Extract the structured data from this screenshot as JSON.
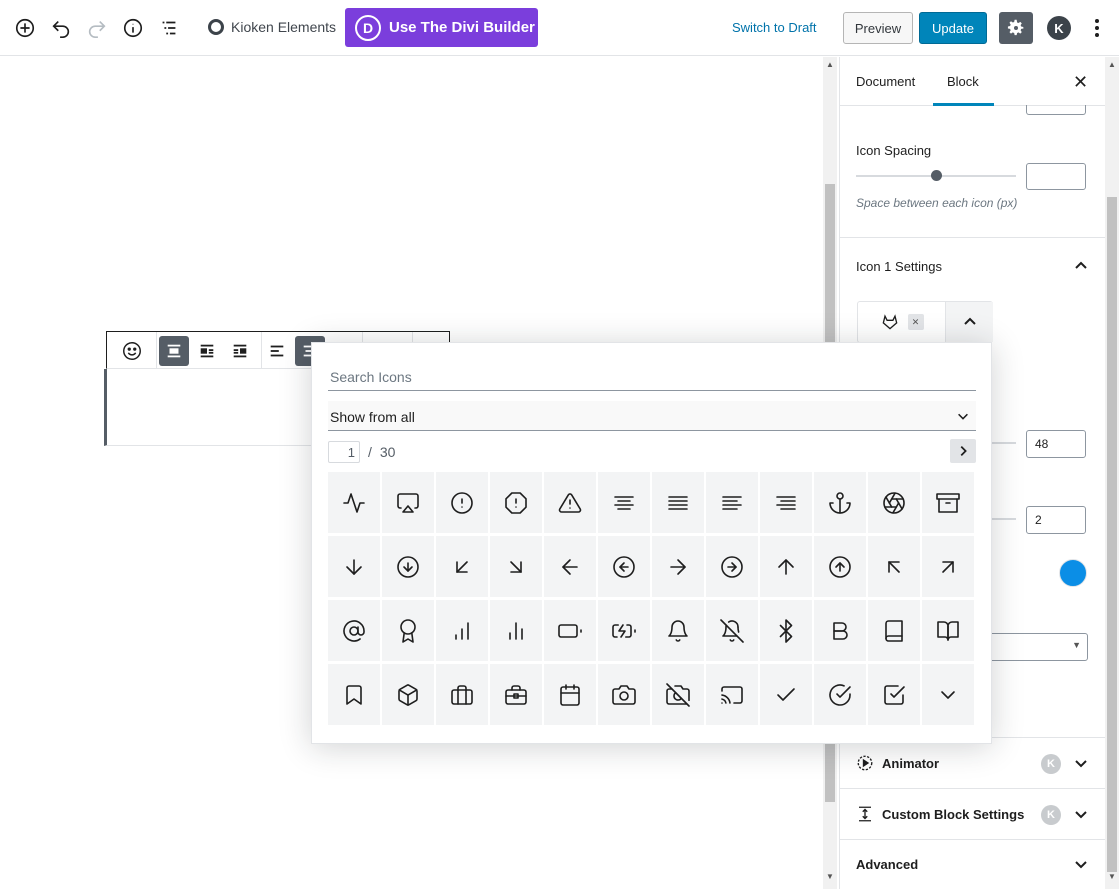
{
  "toolbar": {
    "kioken_label": "Kioken Elements",
    "divi_label": "Use The Divi Builder",
    "divi_letter": "D",
    "switch_draft": "Switch to Draft",
    "preview": "Preview",
    "update": "Update",
    "avatar_letter": "K"
  },
  "sidebar": {
    "tabs": [
      "Document",
      "Block"
    ],
    "active_tab": "Block",
    "close_glyph": "✕",
    "icon_spacing_label": "Icon Spacing",
    "icon_spacing_help": "Space between each icon (px)",
    "icon_spacing_slider_fraction": 0.53,
    "icon1_settings": "Icon 1 Settings",
    "size_value": "48",
    "border_value": "2",
    "accent_color": "#0b8ee6",
    "panels": {
      "animator": "Animator",
      "custom_block_settings": "Custom Block Settings",
      "advanced": "Advanced"
    },
    "k_badge": "K"
  },
  "icon_picker": {
    "search_placeholder": "Search Icons",
    "filter_label": "Show from all",
    "page_current": "1",
    "page_separator": "/",
    "page_total": "30",
    "icons": [
      "activity-icon",
      "airplay-icon",
      "alert-circle-icon",
      "alert-octagon-icon",
      "alert-triangle-icon",
      "align-center-icon",
      "align-justify-icon",
      "align-left-icon",
      "align-right-icon",
      "anchor-icon",
      "aperture-icon",
      "archive-icon",
      "arrow-down-icon",
      "arrow-down-circle-icon",
      "arrow-down-left-icon",
      "arrow-down-right-icon",
      "arrow-left-icon",
      "arrow-left-circle-icon",
      "arrow-right-icon",
      "arrow-right-circle-icon",
      "arrow-up-icon",
      "arrow-up-circle-icon",
      "arrow-up-left-icon",
      "arrow-up-right-icon",
      "at-sign-icon",
      "award-icon",
      "bar-chart-icon",
      "bar-chart-2-icon",
      "battery-icon",
      "battery-charging-icon",
      "bell-icon",
      "bell-off-icon",
      "bluetooth-icon",
      "bold-icon",
      "book-icon",
      "book-open-icon",
      "bookmark-icon",
      "box-icon",
      "briefcase-icon",
      "briefcase-alt-icon",
      "calendar-icon",
      "camera-icon",
      "camera-off-icon",
      "cast-icon",
      "check-icon",
      "check-circle-icon",
      "check-square-icon",
      "chevron-down-icon"
    ]
  }
}
